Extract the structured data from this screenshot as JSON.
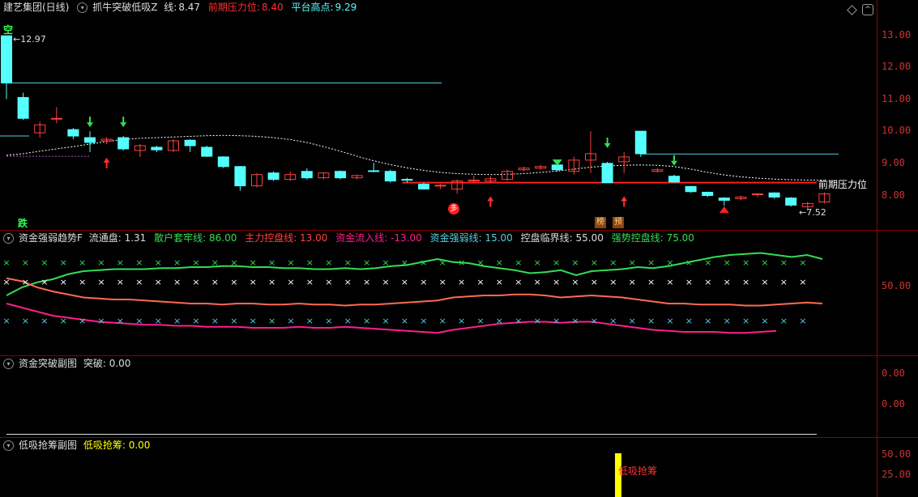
{
  "colors": {
    "up": "#ff4040",
    "down": "#54ffff",
    "ma": "#ffffff",
    "resist": "#ff2020",
    "platform": "#54d0e0",
    "green": "#33dd55",
    "orange": "#ff6a50",
    "magenta": "#ff1e8c",
    "yellow": "#ffff00",
    "tick": "#cc3333"
  },
  "main": {
    "stock_name": "建艺集团(日线)",
    "indicator_name": "抓牛突破低吸Z",
    "line_label": "线:",
    "line_value": "8.47",
    "resist_label": "前期压力位:",
    "resist_value": "8.40",
    "platform_label": "平台高点:",
    "platform_value": "9.29",
    "high_price": "←12.97",
    "low_price": "←7.52",
    "resist_text": "前期压力位",
    "tag_kong": "空",
    "tag_die": "跌",
    "tag_duo": "多",
    "tag_bang": "榜",
    "tag_yu": "预",
    "y_ticks": [
      "13.00",
      "12.00",
      "11.00",
      "10.00",
      "9.00",
      "8.00"
    ]
  },
  "chart_data": [
    {
      "type": "candlestick",
      "title": "建艺集团(日线)",
      "ylim": [
        7.2,
        13.6
      ],
      "candles": [
        {
          "o": 12.97,
          "c": 11.5,
          "h": 12.97,
          "l": 11.0
        },
        {
          "o": 11.05,
          "c": 10.4,
          "h": 11.2,
          "l": 10.35
        },
        {
          "o": 9.95,
          "c": 10.2,
          "h": 10.3,
          "l": 9.8
        },
        {
          "o": 10.4,
          "c": 10.4,
          "h": 10.75,
          "l": 10.25
        },
        {
          "o": 10.05,
          "c": 9.85,
          "h": 10.1,
          "l": 9.75
        },
        {
          "o": 9.8,
          "c": 9.65,
          "h": 10.0,
          "l": 9.35
        },
        {
          "o": 9.7,
          "c": 9.75,
          "h": 9.82,
          "l": 9.6
        },
        {
          "o": 9.8,
          "c": 9.45,
          "h": 9.85,
          "l": 9.4
        },
        {
          "o": 9.4,
          "c": 9.55,
          "h": 9.6,
          "l": 9.2
        },
        {
          "o": 9.5,
          "c": 9.42,
          "h": 9.55,
          "l": 9.35
        },
        {
          "o": 9.4,
          "c": 9.7,
          "h": 9.75,
          "l": 9.35
        },
        {
          "o": 9.72,
          "c": 9.55,
          "h": 9.75,
          "l": 9.35
        },
        {
          "o": 9.5,
          "c": 9.22,
          "h": 9.55,
          "l": 9.2
        },
        {
          "o": 9.2,
          "c": 8.9,
          "h": 9.22,
          "l": 8.85
        },
        {
          "o": 8.9,
          "c": 8.3,
          "h": 8.92,
          "l": 8.15
        },
        {
          "o": 8.3,
          "c": 8.65,
          "h": 8.7,
          "l": 8.25
        },
        {
          "o": 8.7,
          "c": 8.5,
          "h": 8.75,
          "l": 8.45
        },
        {
          "o": 8.5,
          "c": 8.65,
          "h": 8.75,
          "l": 8.45
        },
        {
          "o": 8.75,
          "c": 8.55,
          "h": 8.85,
          "l": 8.5
        },
        {
          "o": 8.55,
          "c": 8.7,
          "h": 8.72,
          "l": 8.5
        },
        {
          "o": 8.75,
          "c": 8.55,
          "h": 8.78,
          "l": 8.5
        },
        {
          "o": 8.55,
          "c": 8.62,
          "h": 8.65,
          "l": 8.5
        },
        {
          "o": 8.77,
          "c": 8.75,
          "h": 9.02,
          "l": 8.72
        },
        {
          "o": 8.75,
          "c": 8.45,
          "h": 8.8,
          "l": 8.4
        },
        {
          "o": 8.5,
          "c": 8.48,
          "h": 8.55,
          "l": 8.4
        },
        {
          "o": 8.35,
          "c": 8.2,
          "h": 8.4,
          "l": 8.18
        },
        {
          "o": 8.3,
          "c": 8.32,
          "h": 8.36,
          "l": 8.2
        },
        {
          "o": 8.2,
          "c": 8.45,
          "h": 8.5,
          "l": 8.05
        },
        {
          "o": 8.45,
          "c": 8.48,
          "h": 8.62,
          "l": 8.42
        },
        {
          "o": 8.45,
          "c": 8.52,
          "h": 8.6,
          "l": 8.4
        },
        {
          "o": 8.5,
          "c": 8.75,
          "h": 8.8,
          "l": 8.45
        },
        {
          "o": 8.8,
          "c": 8.85,
          "h": 8.9,
          "l": 8.75
        },
        {
          "o": 8.85,
          "c": 8.9,
          "h": 8.95,
          "l": 8.8
        },
        {
          "o": 8.95,
          "c": 8.8,
          "h": 9.05,
          "l": 8.75
        },
        {
          "o": 8.75,
          "c": 9.1,
          "h": 9.2,
          "l": 8.65
        },
        {
          "o": 9.1,
          "c": 9.3,
          "h": 10.0,
          "l": 8.7
        },
        {
          "o": 9.0,
          "c": 8.4,
          "h": 9.05,
          "l": 8.4
        },
        {
          "o": 9.05,
          "c": 9.2,
          "h": 9.35,
          "l": 8.7
        },
        {
          "o": 10.0,
          "c": 9.3,
          "h": 10.0,
          "l": 9.2
        },
        {
          "o": 8.75,
          "c": 8.8,
          "h": 8.85,
          "l": 8.72
        },
        {
          "o": 8.6,
          "c": 8.42,
          "h": 8.65,
          "l": 8.4
        },
        {
          "o": 8.28,
          "c": 8.12,
          "h": 8.3,
          "l": 8.08
        },
        {
          "o": 8.1,
          "c": 8.0,
          "h": 8.12,
          "l": 7.95
        },
        {
          "o": 7.92,
          "c": 7.85,
          "h": 7.95,
          "l": 7.68
        },
        {
          "o": 7.9,
          "c": 7.95,
          "h": 8.0,
          "l": 7.85
        },
        {
          "o": 8.05,
          "c": 8.05,
          "h": 8.08,
          "l": 7.95
        },
        {
          "o": 8.08,
          "c": 7.95,
          "h": 8.1,
          "l": 7.9
        },
        {
          "o": 7.92,
          "c": 7.7,
          "h": 7.95,
          "l": 7.65
        },
        {
          "o": 7.65,
          "c": 7.75,
          "h": 7.8,
          "l": 7.52
        },
        {
          "o": 7.8,
          "c": 8.05,
          "h": 8.1,
          "l": 7.75
        }
      ],
      "ma": [
        9.25,
        9.3,
        9.38,
        9.45,
        9.52,
        9.6,
        9.68,
        9.74,
        9.78,
        9.8,
        9.82,
        9.84,
        9.86,
        9.87,
        9.86,
        9.84,
        9.8,
        9.74,
        9.65,
        9.52,
        9.38,
        9.22,
        9.08,
        8.96,
        8.86,
        8.78,
        8.72,
        8.68,
        8.66,
        8.65,
        8.66,
        8.68,
        8.72,
        8.76,
        8.82,
        8.88,
        8.92,
        8.94,
        8.95,
        8.94,
        8.9,
        8.82,
        8.72,
        8.64,
        8.58,
        8.54,
        8.51,
        8.49,
        8.48,
        8.47
      ],
      "resist_line": 8.4,
      "platform_line": 9.29
    },
    {
      "type": "line",
      "title": "资金强弱趋势F",
      "ylim": [
        0,
        100
      ],
      "labels": {
        "liutong": "流通盘: 1.31",
        "sanhu": "散户套牢线: 86.00",
        "zhuli": "主力控盘线: 13.00",
        "liuru": "资金流入线: -13.00",
        "qiangruo": "资金强弱线: 15.00",
        "kongpan": "控盘临界线: 55.00",
        "qiangshi": "强势控盘线: 75.00"
      },
      "y_ticks": [
        "50.00"
      ],
      "series": [
        {
          "name": "强势控盘线",
          "values": [
            44,
            52,
            57,
            60,
            65,
            68,
            69,
            70,
            70,
            70,
            71,
            71,
            72,
            72,
            73,
            73,
            72,
            72,
            71,
            71,
            70,
            70,
            71,
            70,
            71,
            73,
            74,
            77,
            80,
            77,
            76,
            73,
            71,
            69,
            66,
            67,
            69,
            64,
            68,
            69,
            70,
            72,
            71,
            73,
            76,
            79,
            82,
            84,
            85,
            86,
            84,
            82,
            84,
            80
          ]
        },
        {
          "name": "资金流入线",
          "values": [
            61,
            58,
            52,
            48,
            45,
            42,
            41,
            40,
            40,
            39,
            38,
            37,
            36,
            36,
            35,
            36,
            36,
            35,
            35,
            36,
            35,
            35,
            34,
            35,
            35,
            36,
            37,
            38,
            39,
            42,
            43,
            44,
            44,
            45,
            45,
            44,
            42,
            43,
            44,
            43,
            42,
            40,
            38,
            36,
            36,
            35,
            35,
            35,
            34,
            34,
            35,
            36,
            37,
            36
          ]
        },
        {
          "name": "资金强弱线",
          "values": [
            36,
            32,
            28,
            24,
            22,
            20,
            18,
            17,
            16,
            15,
            15,
            14,
            14,
            13,
            13,
            13,
            12,
            12,
            12,
            13,
            12,
            12,
            13,
            12,
            11,
            10,
            9,
            8,
            7,
            10,
            12,
            14,
            16,
            17,
            18,
            18,
            17,
            18,
            18,
            16,
            14,
            12,
            10,
            9,
            8,
            8,
            8,
            7,
            7,
            8,
            9
          ]
        }
      ]
    },
    {
      "type": "line",
      "title": "资金突破副图",
      "labels": {
        "tupo": "突破: 0.00"
      },
      "y_ticks": [
        "0.00",
        "0.00"
      ]
    },
    {
      "type": "bar",
      "title": "低吸抢筹副图",
      "labels": {
        "dixi": "低吸抢筹: 0.00",
        "bar_text": "低吸抢筹"
      },
      "y_ticks": [
        "50.00",
        "25.00"
      ],
      "bar_index": 37
    }
  ]
}
